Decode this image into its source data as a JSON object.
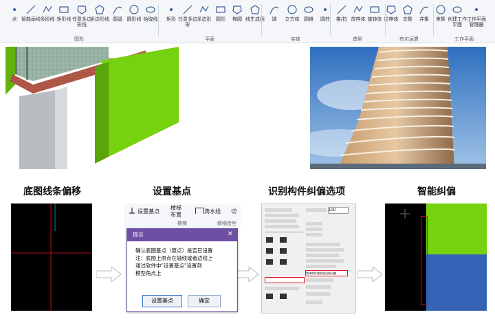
{
  "ribbon": {
    "tools": [
      {
        "label": "点",
        "icon": "point-icon"
      },
      {
        "label": "智能画线",
        "icon": "smart-line-icon"
      },
      {
        "label": "多段线",
        "icon": "polyline-icon"
      },
      {
        "label": "矩形线",
        "icon": "rect-line-icon"
      },
      {
        "label": "任意多边形线",
        "icon": "free-polygon-line-icon"
      },
      {
        "label": "多边形线",
        "icon": "polygon-line-icon"
      },
      {
        "label": "圆弧",
        "icon": "arc-icon"
      },
      {
        "label": "圆形线",
        "icon": "circle-line-icon"
      },
      {
        "label": "拾取线",
        "icon": "pick-line-icon"
      },
      {
        "label": "矩形",
        "icon": "rect-icon"
      },
      {
        "label": "任意多边形",
        "icon": "free-polygon-icon"
      },
      {
        "label": "多边形",
        "icon": "polygon-icon"
      },
      {
        "label": "圆形",
        "icon": "circle-icon"
      },
      {
        "label": "椭圆",
        "icon": "ellipse-icon"
      },
      {
        "label": "线生成面",
        "icon": "line-to-face-icon"
      },
      {
        "label": "球",
        "icon": "sphere-icon"
      },
      {
        "label": "立方体",
        "icon": "cube-icon"
      },
      {
        "label": "圆锥",
        "icon": "cone-icon"
      },
      {
        "label": "圆柱",
        "icon": "cylinder-icon"
      },
      {
        "label": "推/拉",
        "icon": "push-pull-icon"
      },
      {
        "label": "放样体",
        "icon": "loft-icon"
      },
      {
        "label": "旋转体",
        "icon": "revolve-icon"
      },
      {
        "label": "拉伸体",
        "icon": "extrude-icon"
      },
      {
        "label": "交集",
        "icon": "intersect-icon"
      },
      {
        "label": "并集",
        "icon": "union-icon"
      },
      {
        "label": "差集",
        "icon": "difference-icon"
      },
      {
        "label": "创建工作平面",
        "icon": "create-workplane-icon"
      },
      {
        "label": "工作平面管理器",
        "icon": "workplane-manager-icon"
      }
    ],
    "groups": [
      "图形",
      "平面",
      "实体",
      "造型",
      "布尔运算",
      "工作平面"
    ]
  },
  "steps": [
    {
      "title": "底图线条偏移"
    },
    {
      "title": "设置基点"
    },
    {
      "title": "识别构件纠偏选项"
    },
    {
      "title": "智能纠偏"
    }
  ],
  "set_base": {
    "toolbar_base_label": "设置基点",
    "toolbar_stair_label": "楼梯布置",
    "toolbar_gutter_label": "滴水线",
    "toolbar_split_label": "切",
    "tab_stair": "楼梯",
    "tab_fine": "精细造型",
    "dialog_title": "提示",
    "message": "确认底图基点（原点）是否已设置\n注：底图上原点在轴线或者边线上\n通过软件中\"设置基点\"设置到\n模型角点上",
    "btn_set": "设置基点",
    "btn_ok": "确定"
  },
  "options": {
    "field_value": "100",
    "selected_option": "墙体构件按照墙边线纠偏"
  },
  "colors": {
    "green": "#76d10f",
    "blue": "#3563b6",
    "dialog_purple": "#6d4fa3",
    "red_line": "#e0141e"
  }
}
